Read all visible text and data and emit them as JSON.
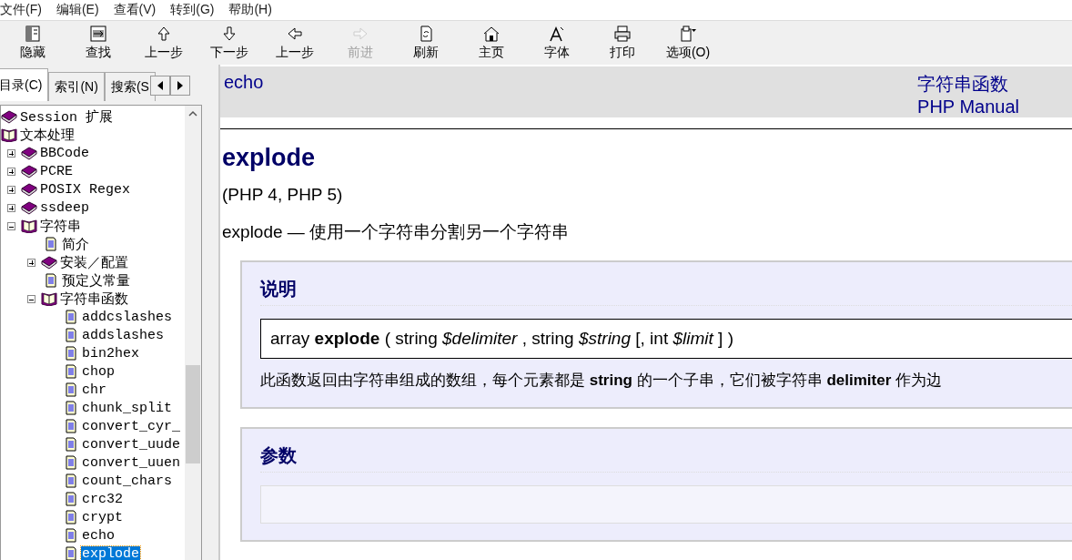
{
  "menu": [
    "文件(F)",
    "编辑(E)",
    "查看(V)",
    "转到(G)",
    "帮助(H)"
  ],
  "toolbar": [
    {
      "label": "隐藏",
      "disabled": false
    },
    {
      "label": "查找",
      "disabled": false
    },
    {
      "label": "上一步",
      "disabled": false
    },
    {
      "label": "下一步",
      "disabled": false
    },
    {
      "label": "上一步",
      "disabled": false
    },
    {
      "label": "前进",
      "disabled": true
    },
    {
      "label": "刷新",
      "disabled": false
    },
    {
      "label": "主页",
      "disabled": false
    },
    {
      "label": "字体",
      "disabled": false
    },
    {
      "label": "打印",
      "disabled": false
    },
    {
      "label": "选项(O)",
      "disabled": false
    }
  ],
  "nav_tabs": [
    {
      "label": "目录(C)",
      "selected": true
    },
    {
      "label": "索引(N)",
      "selected": false
    },
    {
      "label": "搜索(S",
      "selected": false
    }
  ],
  "tree": [
    {
      "kind": "book",
      "label": "Session 扩展",
      "expanded": false,
      "selected": false
    },
    {
      "kind": "book",
      "label": "文本处理",
      "expanded": true,
      "selected": false,
      "children": [
        {
          "kind": "book",
          "label": "BBCode",
          "expanded": false,
          "selected": false
        },
        {
          "kind": "book",
          "label": "PCRE",
          "expanded": false,
          "selected": false
        },
        {
          "kind": "book",
          "label": "POSIX Regex",
          "expanded": false,
          "selected": false
        },
        {
          "kind": "book",
          "label": "ssdeep",
          "expanded": false,
          "selected": false
        },
        {
          "kind": "book",
          "label": "字符串",
          "expanded": true,
          "selected": false,
          "children": [
            {
              "kind": "page",
              "label": "简介",
              "selected": false
            },
            {
              "kind": "book",
              "label": "安装／配置",
              "expanded": false,
              "selected": false
            },
            {
              "kind": "page",
              "label": "预定义常量",
              "selected": false
            },
            {
              "kind": "book",
              "label": "字符串函数",
              "expanded": true,
              "selected": false,
              "children": [
                {
                  "kind": "page",
                  "label": "addcslashes",
                  "selected": false
                },
                {
                  "kind": "page",
                  "label": "addslashes",
                  "selected": false
                },
                {
                  "kind": "page",
                  "label": "bin2hex",
                  "selected": false
                },
                {
                  "kind": "page",
                  "label": "chop",
                  "selected": false
                },
                {
                  "kind": "page",
                  "label": "chr",
                  "selected": false
                },
                {
                  "kind": "page",
                  "label": "chunk_split",
                  "selected": false
                },
                {
                  "kind": "page",
                  "label": "convert_cyr_",
                  "selected": false
                },
                {
                  "kind": "page",
                  "label": "convert_uude",
                  "selected": false
                },
                {
                  "kind": "page",
                  "label": "convert_uuen",
                  "selected": false
                },
                {
                  "kind": "page",
                  "label": "count_chars",
                  "selected": false
                },
                {
                  "kind": "page",
                  "label": "crc32",
                  "selected": false
                },
                {
                  "kind": "page",
                  "label": "crypt",
                  "selected": false
                },
                {
                  "kind": "page",
                  "label": "echo",
                  "selected": false
                },
                {
                  "kind": "page",
                  "label": "explode",
                  "selected": true
                }
              ]
            }
          ]
        }
      ]
    }
  ],
  "page": {
    "prev_link": "echo",
    "up_link": "字符串函数",
    "manual_link": "PHP Manual",
    "title": "explode",
    "versions": "(PHP 4, PHP 5)",
    "refname": "explode",
    "refpurpose": "— 使用一个字符串分割另一个字符串",
    "sections": [
      {
        "title": "说明",
        "synopsis": "array **explode** ( string *$delimiter* , string *$string* [, int *$limit* ] )",
        "text": "此函数返回由字符串组成的数组，每个元素都是 **string** 的一个子串，它们被字符串 **delimiter** 作为边"
      },
      {
        "title": "参数"
      }
    ]
  }
}
